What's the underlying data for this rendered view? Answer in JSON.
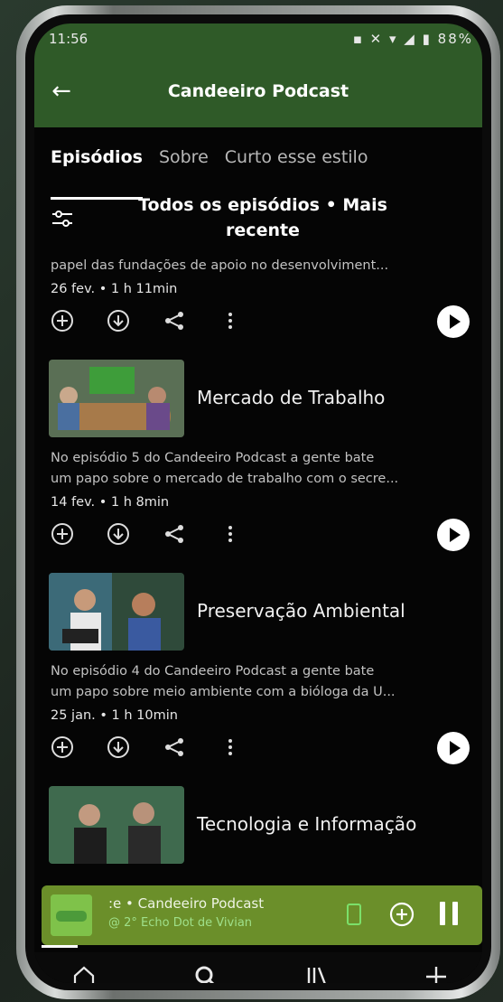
{
  "status": {
    "time": "11:56",
    "battery": "88%",
    "icons": "▪ ✕ ▾ ◢ ▮"
  },
  "header": {
    "title": "Candeeiro Podcast",
    "back_icon": "arrow-left-icon"
  },
  "tabs": [
    {
      "label": "Episódios",
      "active": true
    },
    {
      "label": "Sobre",
      "active": false
    },
    {
      "label": "Curto esse estilo",
      "active": false
    }
  ],
  "filter": {
    "title": "Todos os episódios • Mais recente"
  },
  "episodes": [
    {
      "title": "",
      "description": "papel das fundações de apoio no desenvolviment...",
      "meta": "26 fev. • 1 h 11min"
    },
    {
      "title": "Mercado de Trabalho",
      "description_lines": [
        "No episódio 5 do Candeeiro Podcast a gente bate",
        "um papo sobre o mercado de trabalho com o secre..."
      ],
      "meta": "14 fev. • 1 h 8min"
    },
    {
      "title": "Preservação Ambiental",
      "description_lines": [
        "No episódio 4 do Candeeiro Podcast a gente bate",
        "um papo sobre meio ambiente com a bióloga da U..."
      ],
      "meta": "25 jan. • 1 h 10min"
    },
    {
      "title": "Tecnologia e Informação"
    }
  ],
  "player": {
    "line1": ":e • Candeeiro Podcast",
    "line2": "@ 2° Echo Dot de Vivian"
  },
  "colors": {
    "header": "#2f5a28",
    "player": "#6b8f2a",
    "background": "#050505"
  }
}
